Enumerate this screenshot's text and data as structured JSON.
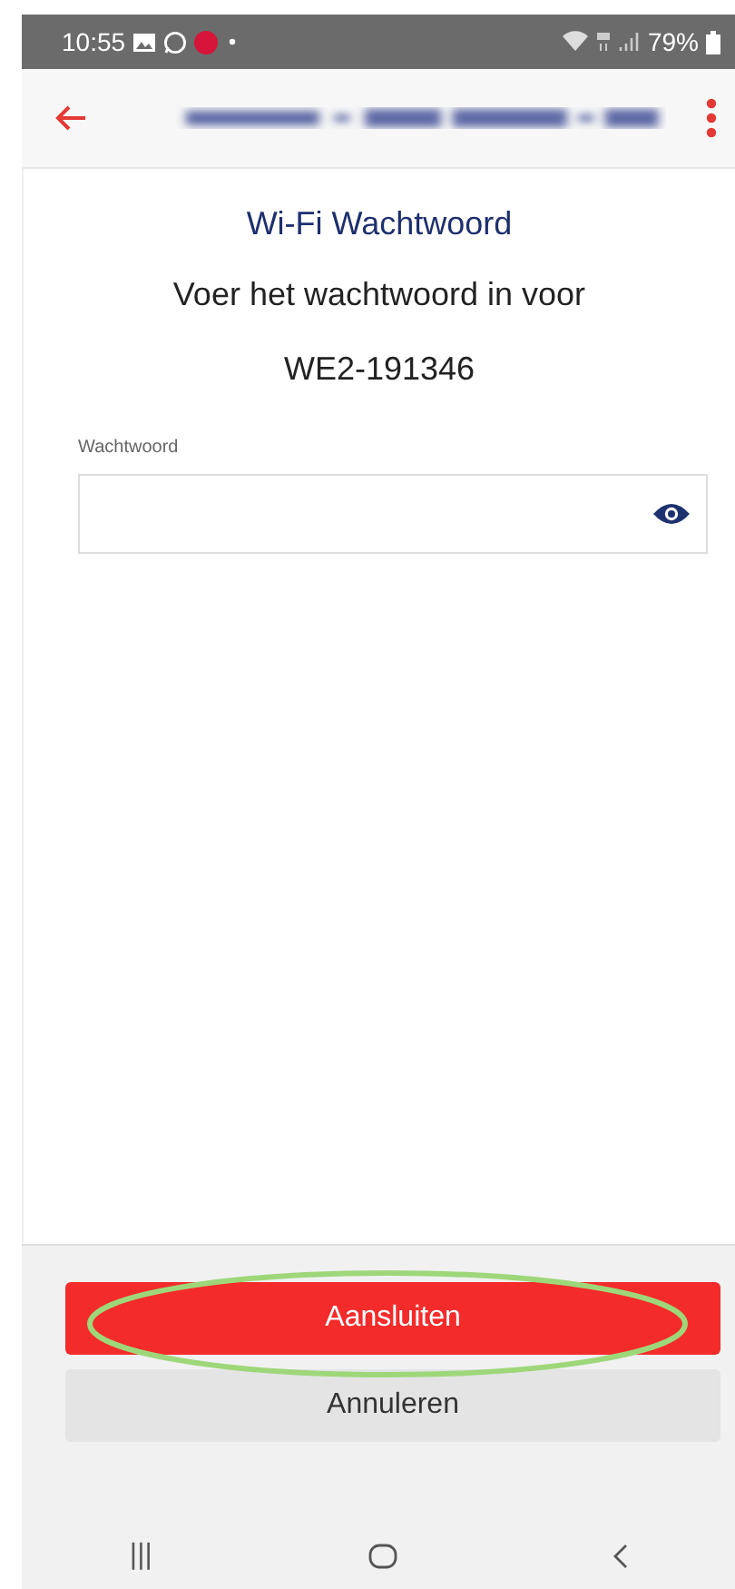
{
  "status_bar": {
    "time": "10:55",
    "battery": "79%"
  },
  "app_bar": {
    "title_blurred": true
  },
  "heading": "Wi-Fi Wachtwoord",
  "prompt": [
    "Voer het wachtwoord in voor",
    "WE2-191346"
  ],
  "password_field": {
    "label": "Wachtwoord"
  },
  "buttons": [
    {
      "label": "Aansluiten",
      "kind": "primary",
      "circled": true
    },
    {
      "label": "Annuleren",
      "kind": "secondary",
      "circled": false
    }
  ],
  "nav_bar": {
    "items": [
      "|||"
    ]
  }
}
